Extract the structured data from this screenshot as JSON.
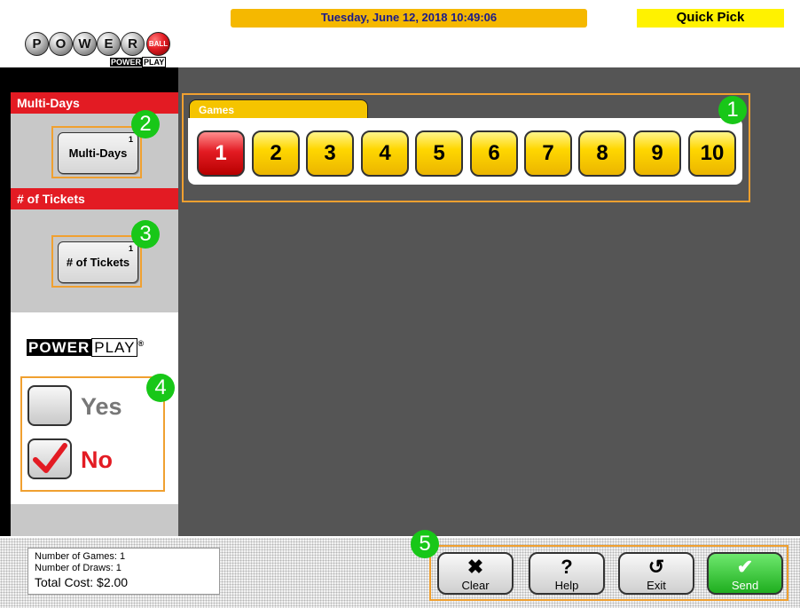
{
  "header": {
    "datetime": "Tuesday, June 12, 2018 10:49:06",
    "mode": "Quick Pick"
  },
  "logo": {
    "letters": [
      "P",
      "O",
      "W",
      "E",
      "R"
    ],
    "ball": "BALL",
    "sub_a": "POWER",
    "sub_b": "PLAY"
  },
  "multi_days": {
    "heading": "Multi-Days",
    "button": "Multi-Days",
    "count": "1",
    "badge": "2"
  },
  "tickets": {
    "heading": "# of Tickets",
    "button": "# of Tickets",
    "count": "1",
    "badge": "3"
  },
  "powerplay": {
    "logo_a": "POWER",
    "logo_b": "PLAY",
    "reg": "®",
    "badge": "4",
    "yes": "Yes",
    "no": "No",
    "selected": "No"
  },
  "games": {
    "tab": "Games",
    "badge": "1",
    "numbers": [
      "1",
      "2",
      "3",
      "4",
      "5",
      "6",
      "7",
      "8",
      "9",
      "10"
    ],
    "selected": "1"
  },
  "summary": {
    "games": "Number of Games: 1",
    "draws": "Number of Draws: 1",
    "total": "Total Cost: $2.00"
  },
  "actions": {
    "badge": "5",
    "clear": "Clear",
    "help": "Help",
    "exit": "Exit",
    "send": "Send"
  },
  "colors": {
    "accent_red": "#e31b23",
    "game_yellow": "#ffd700",
    "badge_green": "#18c718",
    "highlight_orange": "#f0a030"
  }
}
